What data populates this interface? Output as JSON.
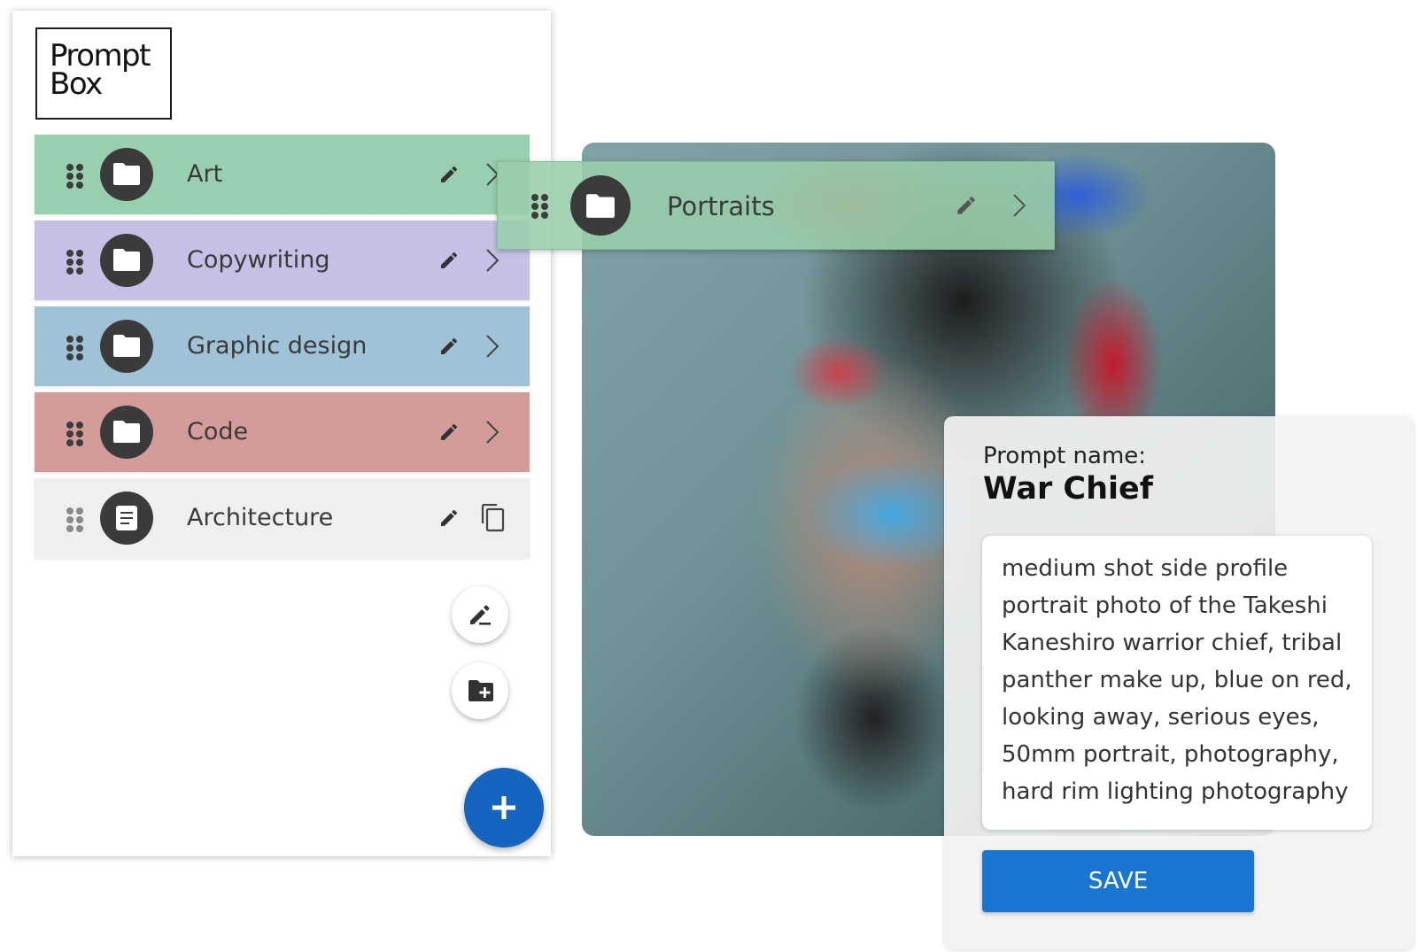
{
  "app": {
    "logo_line1": "Prompt",
    "logo_line2": "Box"
  },
  "folders": [
    {
      "label": "Art",
      "color": "#98cfae",
      "type": "folder"
    },
    {
      "label": "Copywriting",
      "color": "#c4c0e6",
      "type": "folder"
    },
    {
      "label": "Graphic design",
      "color": "#9fc2d6",
      "type": "folder"
    },
    {
      "label": "Code",
      "color": "#d49b9b",
      "type": "folder"
    },
    {
      "label": "Architecture",
      "color": "#efefef",
      "type": "prompt"
    }
  ],
  "dragging_item": {
    "label": "Portraits",
    "color": "#98ceaa"
  },
  "prompt": {
    "name_label": "Prompt name:",
    "name": "War Chief",
    "text": "medium shot side profile portrait photo of the Takeshi Kaneshiro warrior chief, tribal panther make up, blue on red, looking away, serious eyes, 50mm portrait, photography, hard rim lighting photography",
    "save_label": "SAVE"
  },
  "icons": {
    "drag": "drag-handle-icon",
    "folder": "folder-icon",
    "document": "document-icon",
    "edit": "pencil-icon",
    "chevron": "chevron-right-icon",
    "copy": "copy-icon",
    "new_prompt": "edit-line-icon",
    "new_folder": "folder-add-icon",
    "add": "plus-icon"
  },
  "colors": {
    "accent": "#1565c0",
    "save_button": "#1976d2"
  }
}
